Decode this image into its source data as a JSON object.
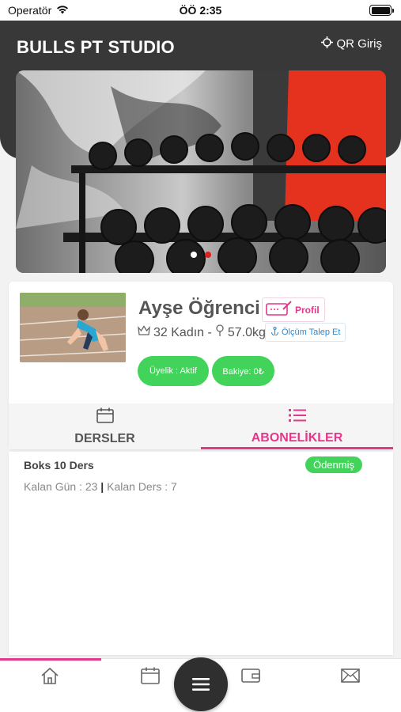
{
  "status_bar": {
    "carrier": "Operatör",
    "time": "ÖÖ 2:35"
  },
  "header": {
    "title": "BULLS PT STUDIO",
    "qr_label": "QR Giriş"
  },
  "banner": {
    "slide_count": 2,
    "active_slide": 2
  },
  "profile": {
    "name": "Ayşe Öğrenci",
    "profile_button": "Profil",
    "age_gender": "32 Kadın -",
    "weight": "57.0kg",
    "measure_button": "Ölçüm Talep Et",
    "membership": "Üyelik : Aktif",
    "balance": "Bakiye: 0₺"
  },
  "tabs": [
    {
      "label": "DERSLER",
      "icon": "calendar-icon",
      "active": false
    },
    {
      "label": "ABONELİKLER",
      "icon": "list-icon",
      "active": true
    }
  ],
  "subscription": {
    "title": "Boks 10 Ders",
    "status": "Ödenmiş",
    "days_label": "Kalan Gün : 23",
    "separator": "|",
    "lessons_label": "Kalan Ders : 7"
  },
  "bottom_nav": {
    "items": [
      "home-icon",
      "calendar-icon",
      "wallet-icon",
      "mail-icon"
    ],
    "center": "menu-icon",
    "active_index": 0
  },
  "colors": {
    "accent": "#e3388a",
    "success": "#42d35a",
    "header_bg": "#383838",
    "dot_active": "#e0201c"
  }
}
